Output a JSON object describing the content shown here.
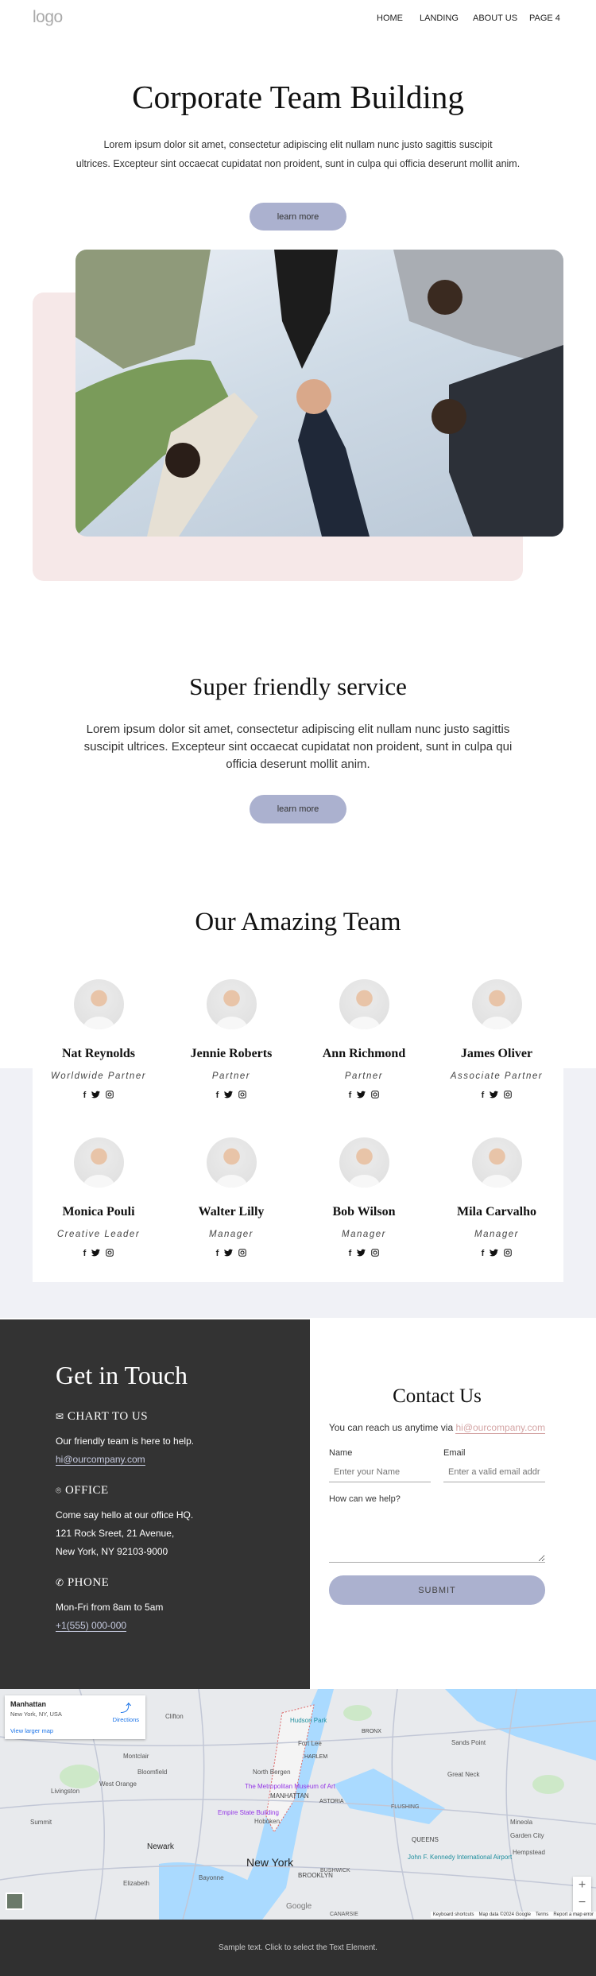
{
  "header": {
    "logo": "logo",
    "nav": [
      "HOME",
      "LANDING",
      "ABOUT US",
      "PAGE 4"
    ]
  },
  "hero": {
    "title": "Corporate Team Building",
    "lines": [
      "Lorem ipsum dolor sit amet, consectetur adipiscing elit nullam nunc justo sagittis suscipit",
      "ultrices. Excepteur sint occaecat cupidatat non proident, sunt in culpa qui officia deserunt mollit anim."
    ],
    "button": "learn more"
  },
  "service": {
    "title": "Super friendly service",
    "lines": [
      "Lorem ipsum dolor sit amet, consectetur adipiscing elit nullam nunc justo sagittis",
      "suscipit ultrices. Excepteur sint occaecat cupidatat non proident, sunt in culpa qui",
      "officia deserunt mollit anim."
    ],
    "button": "learn more"
  },
  "team": {
    "title": "Our Amazing Team",
    "members": [
      {
        "name": "Nat Reynolds",
        "role": "Worldwide Partner"
      },
      {
        "name": "Jennie Roberts",
        "role": "Partner"
      },
      {
        "name": "Ann Richmond",
        "role": "Partner"
      },
      {
        "name": "James Oliver",
        "role": "Associate Partner"
      },
      {
        "name": "Monica Pouli",
        "role": "Creative Leader"
      },
      {
        "name": "Walter Lilly",
        "role": "Manager"
      },
      {
        "name": "Bob Wilson",
        "role": "Manager"
      },
      {
        "name": "Mila Carvalho",
        "role": "Manager"
      }
    ],
    "social": [
      "f",
      "twitter",
      "instagram"
    ]
  },
  "touch": {
    "title": "Get in Touch",
    "chat": {
      "heading": "CHART TO US",
      "text": "Our friendly team is here to help.",
      "email": "hi@ourcompany.com"
    },
    "office": {
      "heading": "OFFICE",
      "lines": [
        "Come say hello at our office HQ.",
        "121 Rock Sreet, 21 Avenue,",
        "New York, NY 92103-9000"
      ]
    },
    "phone": {
      "heading": "PHONE",
      "text": "Mon-Fri from 8am to 5am",
      "number": "+1(555) 000-000"
    }
  },
  "contact": {
    "title": "Contact Us",
    "intro": "You can reach us anytime via ",
    "email": "hi@ourcompany.com",
    "name_label": "Name",
    "name_placeholder": "Enter your Name",
    "email_label": "Email",
    "email_placeholder": "Enter a valid email address",
    "message_label": "How can we help?",
    "submit": "SUBMIT"
  },
  "map": {
    "place": "Manhattan",
    "address": "New York, NY, USA",
    "directions": "Directions",
    "larger": "View larger map",
    "labels": [
      "New York",
      "Newark",
      "MANHATTAN",
      "BROOKLYN",
      "QUEENS",
      "HARLEM",
      "BRONX",
      "ASTORIA",
      "Hoboken",
      "Clifton",
      "Montclair",
      "Bloomfield",
      "West Orange",
      "Livingston",
      "Summit",
      "Elizabeth",
      "Bayonne",
      "FLUSHING",
      "Great Neck",
      "Mineola",
      "Hempstead",
      "Garden City",
      "Sands Point",
      "Fort Lee",
      "North Bergen",
      "The Metropolitan Museum of Art",
      "Empire State Building",
      "John F. Kennedy International Airport",
      "Hudson Park",
      "CANARSIE",
      "BUSHWICK"
    ],
    "footer": [
      "Keyboard shortcuts",
      "Map data ©2024 Google",
      "Terms",
      "Report a map error"
    ],
    "google": "Google"
  },
  "footer": {
    "text": "Sample text. Click to select the Text Element."
  },
  "colors": {
    "accent": "#abb1cf",
    "pink_bg": "#f6e8e8",
    "dark": "#333333",
    "link": "#d4a5a5"
  }
}
